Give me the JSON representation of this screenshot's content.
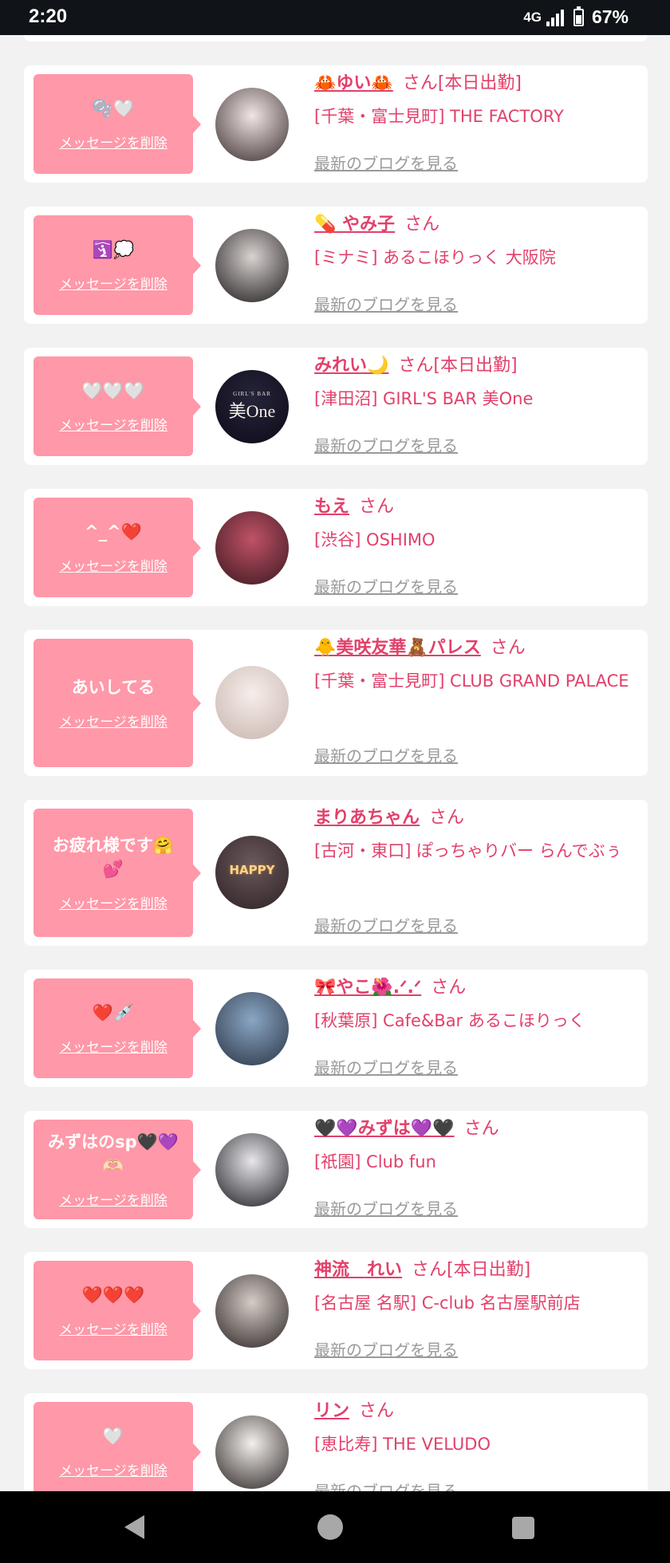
{
  "status": {
    "time": "2:20",
    "network": "4G",
    "battery": "67%",
    "battery_level": 0.67
  },
  "delete_label": "メッセージを削除",
  "blog_label": "最新のブログを見る",
  "honorific": "さん",
  "cards": [
    {
      "message": "🫧🤍",
      "name": "🦀ゆい🦀",
      "suffix": "[本日出勤]",
      "shop": "[千葉・富士見町] THE FACTORY",
      "avatar_colors": [
        "#f0e6e4",
        "#3a2d2e"
      ]
    },
    {
      "message": "🛐💭",
      "name": "💊 やみ子",
      "suffix": "",
      "shop": "[ミナミ] あるこほりっく 大阪院",
      "avatar_colors": [
        "#d8d2d0",
        "#1e1a1b"
      ]
    },
    {
      "message": "🤍🤍🤍",
      "name": "みれい🌙",
      "suffix": "[本日出勤]",
      "shop": "[津田沼] GIRL'S BAR 美One",
      "avatar_colors": [
        "#26243a",
        "#0d0c18"
      ],
      "logo": {
        "top": "GIRL'S BAR",
        "main": "美One"
      }
    },
    {
      "message": "^_^❤️",
      "name": "もえ",
      "suffix": "",
      "shop": "[渋谷] OSHIMO",
      "avatar_colors": [
        "#c05266",
        "#3a1820"
      ]
    },
    {
      "message": "あいしてる",
      "name": "🐥美咲友華🧸パレス",
      "suffix": "",
      "shop": "[千葉・富士見町] CLUB GRAND PALACE",
      "avatar_colors": [
        "#f6eeea",
        "#c8b4ae"
      ]
    },
    {
      "message": "お疲れ様です🤗\n💕",
      "name": "まりあちゃん",
      "suffix": "",
      "shop": "[古河・東口] ぽっちゃりバー らんでぶぅ",
      "avatar_colors": [
        "#6a585c",
        "#2e2224"
      ],
      "avatar_text": "HAPPY"
    },
    {
      "message": "❤️💉",
      "name": "🎀やこ🌺.ᐟ.ᐟ",
      "suffix": "",
      "shop": "[秋葉原] Cafe&Bar あるこほりっく",
      "avatar_colors": [
        "#8aa6c4",
        "#2a3444"
      ]
    },
    {
      "message": "みずはのsp🖤💜\n🫶🏻",
      "name": "🖤💜みずは💜🖤",
      "suffix": "",
      "shop": "[祇園] Club fun",
      "avatar_colors": [
        "#e8e6ea",
        "#1c1c20"
      ]
    },
    {
      "message": "❤️❤️❤️",
      "name": "神流　れい",
      "suffix": "[本日出勤]",
      "shop": "[名古屋 名駅] C-club 名古屋駅前店",
      "avatar_colors": [
        "#d6ccc6",
        "#2a2424"
      ]
    },
    {
      "message": "🤍",
      "name": "リン",
      "suffix": "",
      "shop": "[恵比寿] THE VELUDO",
      "avatar_colors": [
        "#f4f0ec",
        "#2a2424"
      ]
    }
  ]
}
